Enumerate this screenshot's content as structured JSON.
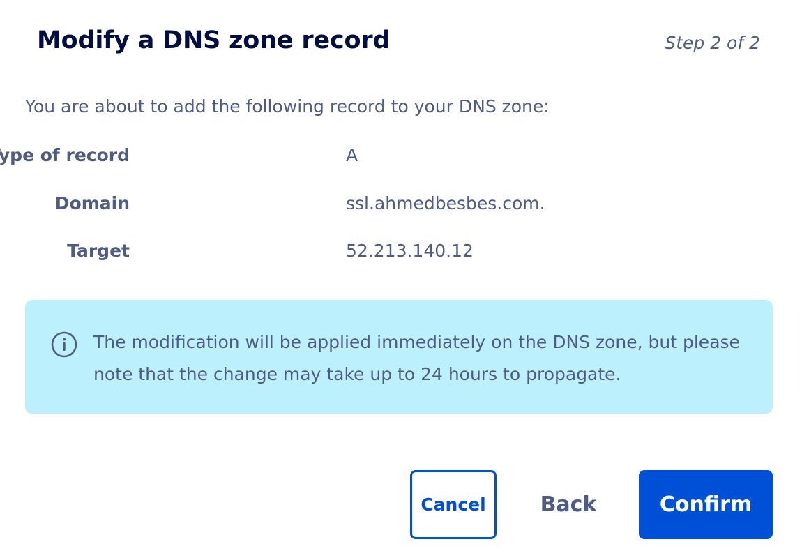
{
  "dialog": {
    "title": "Modify a DNS zone record",
    "step": "Step 2 of 2",
    "intro": "You are about to add the following record to your DNS zone:"
  },
  "record": {
    "rows": [
      {
        "label": "Type of record",
        "value": "A"
      },
      {
        "label": "Domain",
        "value": "ssl.ahmedbesbes.com."
      },
      {
        "label": "Target",
        "value": "52.213.140.12"
      }
    ]
  },
  "notice": {
    "icon": "info-icon",
    "text": "The modification will be applied immediately on the DNS zone, but please note that the change may take up to 24 hours to propagate."
  },
  "actions": {
    "cancel_label": "Cancel",
    "back_label": "Back",
    "confirm_label": "Confirm"
  },
  "colors": {
    "title": "#000e43",
    "text": "#4d5b86",
    "primary": "#0050d7",
    "notice_background": "#bdf0fd"
  }
}
